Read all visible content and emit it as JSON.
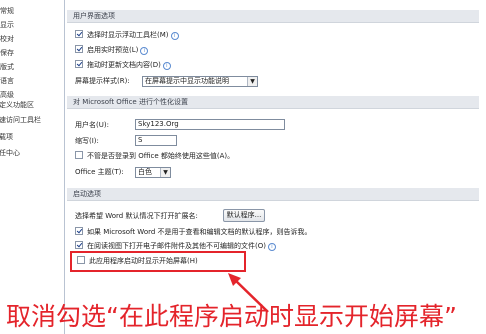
{
  "sidebar": {
    "items": [
      {
        "label": "常规"
      },
      {
        "label": "显示"
      },
      {
        "label": "校对"
      },
      {
        "label": "保存"
      },
      {
        "label": "版式"
      },
      {
        "label": "语言"
      },
      {
        "label": "高级"
      },
      {
        "label": "自定义功能区"
      },
      {
        "label": "快速访问工具栏"
      },
      {
        "label": "加载项"
      },
      {
        "label": "信任中心"
      }
    ]
  },
  "ui_section": {
    "header": "用户界面选项",
    "options": [
      {
        "label": "选择时显示浮动工具栏(M)",
        "checked": true,
        "info": true
      },
      {
        "label": "启用实时预览(L)",
        "checked": true,
        "info": true
      },
      {
        "label": "拖动时更新文档内容(D)",
        "checked": true,
        "info": true
      }
    ],
    "screentip_label": "屏幕提示样式(R):",
    "screentip_value": "在屏幕提示中显示功能说明"
  },
  "personalize_section": {
    "header": "对 Microsoft Office 进行个性化设置",
    "username_label": "用户名(U):",
    "username_value": "Sky123.Org",
    "initials_label": "缩写(I):",
    "initials_value": "S",
    "always_use_label": "不管是否登录到 Office 都始终使用这些值(A)。",
    "theme_label": "Office 主题(T):",
    "theme_value": "白色"
  },
  "startup_section": {
    "header": "启动选项",
    "ext_label": "选择希望 Word 默认情况下打开扩展名:",
    "ext_button": "默认程序...",
    "tell_me_label": "如果 Microsoft Word 不是用于查看和编辑文档的默认程序，则告诉我。",
    "reading_view_label": "在阅读视图下打开电子邮件附件及其他不可编辑的文件(O)",
    "start_screen_label": "此应用程序启动时显示开始屏幕(H)"
  },
  "annotation": {
    "text": "取消勾选“在此程序启动时显示开始屏幕”",
    "color": "#e4242b"
  }
}
